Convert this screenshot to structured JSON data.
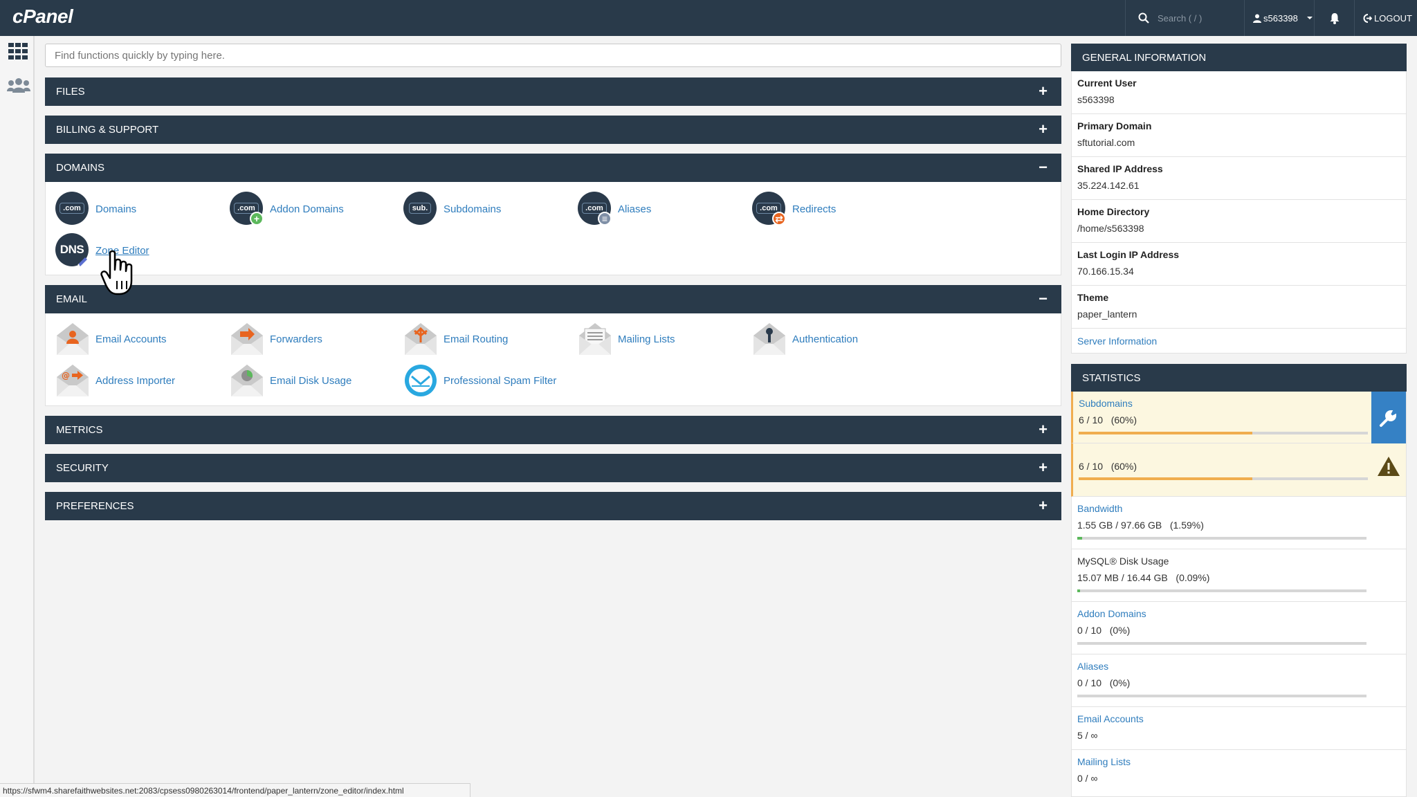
{
  "topbar": {
    "logo": "cPanel",
    "search_placeholder": "Search ( / )",
    "username": "s563398",
    "logout": "LOGOUT"
  },
  "main": {
    "quick_search_placeholder": "Find functions quickly by typing here.",
    "sections": {
      "files": {
        "title": "FILES",
        "toggle": "+"
      },
      "billing": {
        "title": "BILLING & SUPPORT",
        "toggle": "+"
      },
      "domains": {
        "title": "DOMAINS",
        "toggle": "−",
        "items": [
          "Domains",
          "Addon Domains",
          "Subdomains",
          "Aliases",
          "Redirects",
          "Zone Editor"
        ]
      },
      "email": {
        "title": "EMAIL",
        "toggle": "−",
        "items": [
          "Email Accounts",
          "Forwarders",
          "Email Routing",
          "Mailing Lists",
          "Authentication",
          "Address Importer",
          "Email Disk Usage",
          "Professional Spam Filter"
        ]
      },
      "metrics": {
        "title": "METRICS",
        "toggle": "+"
      },
      "security": {
        "title": "SECURITY",
        "toggle": "+"
      },
      "preferences": {
        "title": "PREFERENCES",
        "toggle": "+"
      }
    },
    "icon_text": {
      "com": ".com",
      "sub": "sub.",
      "dns": "DNS"
    }
  },
  "general_info": {
    "title": "GENERAL INFORMATION",
    "rows": [
      {
        "key": "Current User",
        "value": "s563398"
      },
      {
        "key": "Primary Domain",
        "value": "sftutorial.com"
      },
      {
        "key": "Shared IP Address",
        "value": "35.224.142.61"
      },
      {
        "key": "Home Directory",
        "value": "/home/s563398"
      },
      {
        "key": "Last Login IP Address",
        "value": "70.166.15.34"
      },
      {
        "key": "Theme",
        "value": "paper_lantern"
      }
    ],
    "server_info_link": "Server Information"
  },
  "statistics": {
    "title": "STATISTICS",
    "rows": [
      {
        "label": "Subdomains",
        "value": "6 / 10   (60%)",
        "fraction": 0.6,
        "color": "#f0ad4e",
        "warn": true
      },
      {
        "label": "",
        "value": "6 / 10   (60%)",
        "fraction": 0.6,
        "color": "#f0ad4e",
        "warn": true
      },
      {
        "label": "Bandwidth",
        "value": "1.55 GB / 97.66 GB   (1.59%)",
        "fraction": 0.0159,
        "color": "#5cb85c"
      },
      {
        "label": "MySQL® Disk Usage",
        "value": "15.07 MB / 16.44 GB   (0.09%)",
        "fraction": 0.0009,
        "color": "#5cb85c"
      },
      {
        "label": "Addon Domains",
        "value": "0 / 10   (0%)",
        "fraction": 0,
        "color": "#5cb85c"
      },
      {
        "label": "Aliases",
        "value": "0 / 10   (0%)",
        "fraction": 0,
        "color": "#5cb85c"
      },
      {
        "label": "Email Accounts",
        "value": "5 / ∞"
      },
      {
        "label": "Mailing Lists",
        "value": "0 / ∞"
      }
    ]
  },
  "statusbar": {
    "url": "https://sfwm4.sharefaithwebsites.net:2083/cpsess0980263014/frontend/paper_lantern/zone_editor/index.html"
  },
  "colors": {
    "header_bg": "#293a4a",
    "link": "#2f7dbd",
    "warning": "#f0ad4e",
    "ok": "#5cb85c"
  }
}
